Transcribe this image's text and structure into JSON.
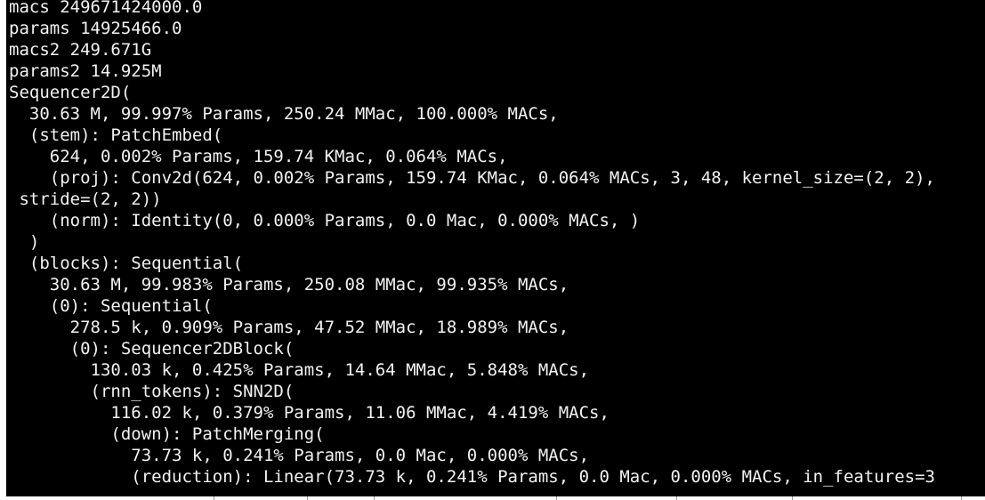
{
  "terminal": {
    "background": "#000000",
    "foreground": "#f2f2f2",
    "lines": [
      "macs 249671424000.0",
      "params 14925466.0",
      "macs2 249.671G",
      "params2 14.925M",
      "Sequencer2D(",
      "  30.63 M, 99.997% Params, 250.24 MMac, 100.000% MACs,",
      "  (stem): PatchEmbed(",
      "    624, 0.002% Params, 159.74 KMac, 0.064% MACs,",
      "    (proj): Conv2d(624, 0.002% Params, 159.74 KMac, 0.064% MACs, 3, 48, kernel_size=(2, 2),",
      " stride=(2, 2))",
      "    (norm): Identity(0, 0.000% Params, 0.0 Mac, 0.000% MACs, )",
      "  )",
      "  (blocks): Sequential(",
      "    30.63 M, 99.983% Params, 250.08 MMac, 99.935% MACs,",
      "    (0): Sequential(",
      "      278.5 k, 0.909% Params, 47.52 MMac, 18.989% MACs,",
      "      (0): Sequencer2DBlock(",
      "        130.03 k, 0.425% Params, 14.64 MMac, 5.848% MACs,",
      "        (rnn_tokens): SNN2D(",
      "          116.02 k, 0.379% Params, 11.06 MMac, 4.419% MACs,",
      "          (down): PatchMerging(",
      "            73.73 k, 0.241% Params, 0.0 Mac, 0.000% MACs,",
      "            (reduction): Linear(73.73 k, 0.241% Params, 0.0 Mac, 0.000% MACs, in_features=3"
    ]
  }
}
